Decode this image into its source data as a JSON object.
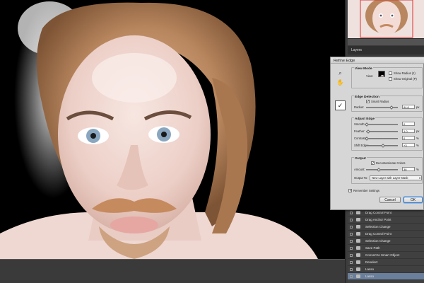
{
  "dialog": {
    "title": "Refine Edge",
    "view_mode": {
      "title": "View Mode",
      "view_label": "View:",
      "show_radius": "Show Radius (J)",
      "show_original": "Show Original (P)"
    },
    "edge_detection": {
      "title": "Edge Detection",
      "smart_radius": "Smart Radius",
      "radius_label": "Radius:",
      "radius_value": "94.6",
      "radius_unit": "px",
      "radius_level": 0.78
    },
    "adjust_edge": {
      "title": "Adjust Edge",
      "rows": [
        {
          "label": "Smooth:",
          "value": "0",
          "unit": "",
          "level": 0.0
        },
        {
          "label": "Feather:",
          "value": "1.0",
          "unit": "px",
          "level": 0.04
        },
        {
          "label": "Contrast:",
          "value": "0",
          "unit": "%",
          "level": 0.0
        },
        {
          "label": "Shift Edge:",
          "value": "+3",
          "unit": "%",
          "level": 0.52
        }
      ]
    },
    "output": {
      "title": "Output",
      "decontaminate": "Decontaminate Colors",
      "amount_label": "Amount:",
      "amount_value": "38",
      "amount_unit": "%",
      "amount_level": 0.38,
      "output_to_label": "Output To:",
      "output_to_value": "New Layer with Layer Mask"
    },
    "remember_settings": "Remember Settings",
    "cancel_label": "Cancel",
    "ok_label": "OK"
  },
  "panels": {
    "layers_tab": "Layers",
    "history_items": [
      "Drag Control Point",
      "Drag Anchor Point",
      "Selection Change",
      "Drag Control Point",
      "Selection Change",
      "Save Path",
      "Convert to Smart Object",
      "Deselect",
      "Lasso",
      "Lasso"
    ]
  },
  "colors": {
    "hair": "#b9875f",
    "skin": "#f1dad4",
    "selected_row": "#6a7f9b",
    "ok_highlight": "#3a78c3"
  }
}
